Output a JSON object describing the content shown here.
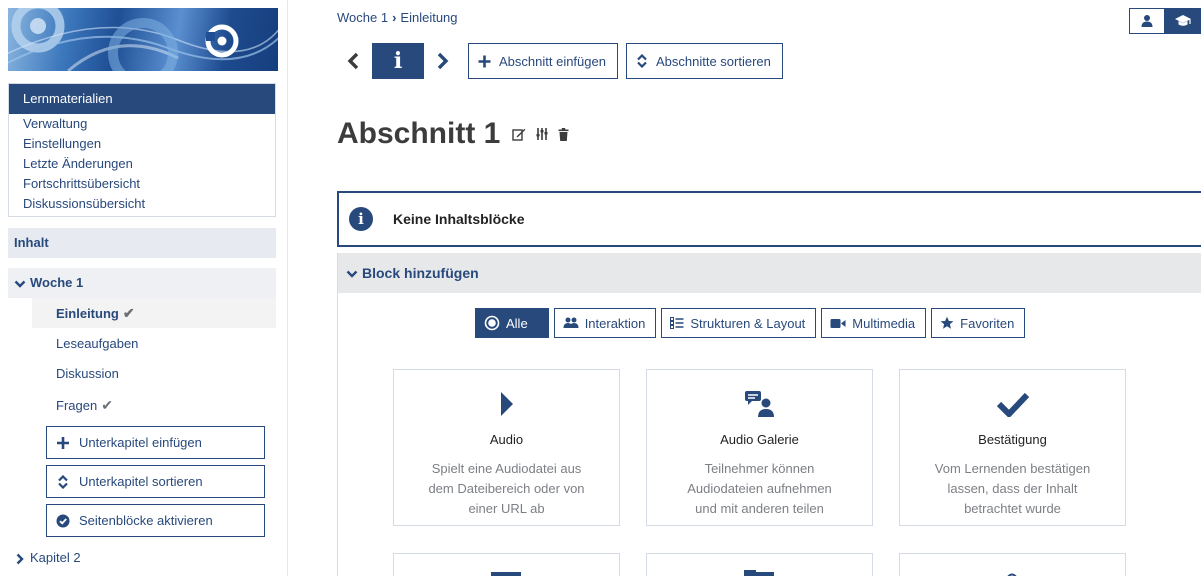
{
  "sidebar": {
    "nav": [
      "Lernmaterialien",
      "Verwaltung",
      "Einstellungen",
      "Letzte Änderungen",
      "Fortschrittsübersicht",
      "Diskussionsübersicht"
    ],
    "content_label": "Inhalt",
    "week_label": "Woche 1",
    "pages": [
      {
        "label": "Einleitung",
        "done": true
      },
      {
        "label": "Leseaufgaben",
        "done": false
      },
      {
        "label": "Diskussion",
        "done": false
      },
      {
        "label": "Fragen",
        "done": true
      }
    ],
    "check_mark": "✔",
    "buttons": {
      "insert_sub": "Unterkapitel einfügen",
      "sort_sub": "Unterkapitel sortieren",
      "activate_blocks": "Seitenblöcke aktivieren"
    },
    "chapter2_label": "Kapitel 2"
  },
  "breadcrumb": {
    "week": "Woche 1",
    "page": "Einleitung"
  },
  "toolbar": {
    "info_glyph": "i",
    "insert_section": "Abschnitt einfügen",
    "sort_sections": "Abschnitte sortieren"
  },
  "section": {
    "title": "Abschnitt 1"
  },
  "empty_notice": {
    "glyph": "i",
    "text": "Keine Inhaltsblöcke"
  },
  "add_block": {
    "heading": "Block hinzufügen",
    "filters": [
      "Alle",
      "Interaktion",
      "Strukturen & Layout",
      "Multimedia",
      "Favoriten"
    ],
    "cards": [
      {
        "title": "Audio",
        "desc": [
          "Spielt eine Audiodatei aus",
          "dem Dateibereich oder von",
          "einer URL ab"
        ],
        "icon": "play-icon"
      },
      {
        "title": "Audio Galerie",
        "desc": [
          "Teilnehmer können",
          "Audiodateien aufnehmen",
          "und mit anderen teilen"
        ],
        "icon": "chat-user-icon"
      },
      {
        "title": "Bestätigung",
        "desc": [
          "Vom Lernenden bestätigen",
          "lassen, dass der Inhalt",
          "betrachtet wurde"
        ],
        "icon": "checkmark-icon"
      }
    ]
  },
  "colors": {
    "primary": "#28497c",
    "muted": "#7c7f85",
    "panel": "#e7e8ea"
  }
}
